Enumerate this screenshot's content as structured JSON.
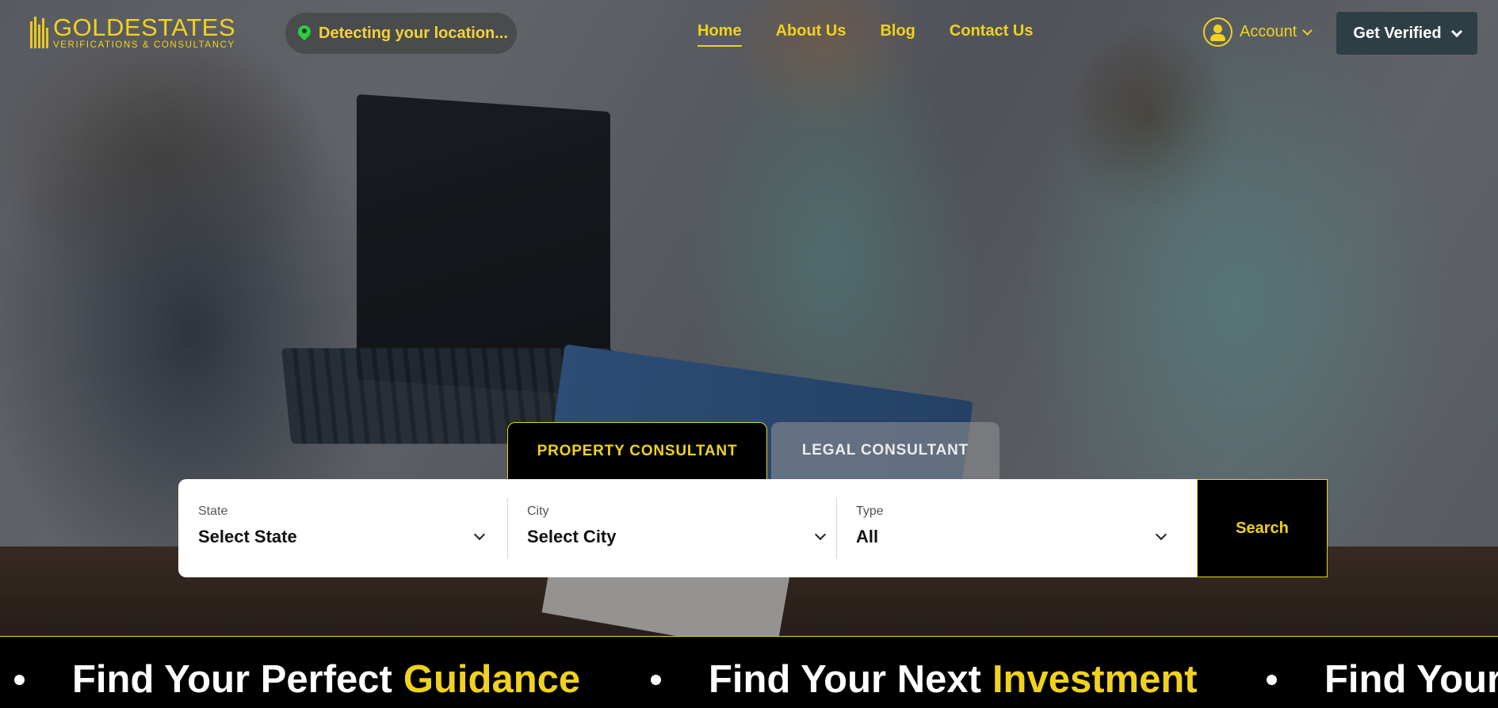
{
  "header": {
    "logo_title": "GOLDESTATES",
    "logo_subtitle": "VERIFICATIONS & CONSULTANCY",
    "location_text": "Detecting your location...",
    "nav": [
      {
        "label": "Home",
        "active": true
      },
      {
        "label": "About Us",
        "active": false
      },
      {
        "label": "Blog",
        "active": false
      },
      {
        "label": "Contact Us",
        "active": false
      }
    ],
    "account_label": "Account",
    "verify_label": "Get Verified"
  },
  "tabs": [
    {
      "label": "PROPERTY CONSULTANT",
      "active": true
    },
    {
      "label": "LEGAL CONSULTANT",
      "active": false
    }
  ],
  "search": {
    "state_label": "State",
    "state_value": "Select State",
    "city_label": "City",
    "city_value": "Select City",
    "type_label": "Type",
    "type_value": "All",
    "button_label": "Search"
  },
  "marquee": [
    {
      "prefix": "Find Your Perfect",
      "highlight": "Guidance"
    },
    {
      "prefix": "Find Your Next",
      "highlight": "Investment"
    },
    {
      "prefix": "Find Your",
      "highlight": ""
    }
  ],
  "colors": {
    "accent": "#f0d21e",
    "button_dark": "#2d3f45",
    "strip_bg": "#000000"
  }
}
